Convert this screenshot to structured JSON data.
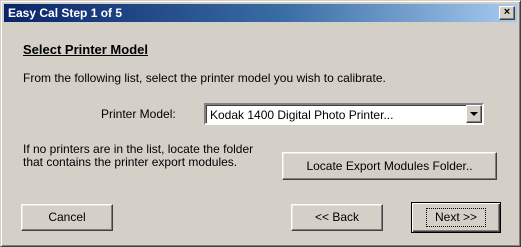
{
  "window": {
    "title": "Easy Cal Step 1 of 5",
    "close_glyph": "×"
  },
  "content": {
    "heading": "Select Printer Model",
    "instruction": "From the following list, select the printer model you wish to calibrate.",
    "model_label": "Printer Model:",
    "model_selected": "Kodak 1400 Digital Photo Printer...",
    "note": "If no printers are in the list, locate the folder that contains the printer export modules."
  },
  "buttons": {
    "locate": "Locate Export Modules Folder..",
    "cancel": "Cancel",
    "back": "<< Back",
    "next": "Next >>"
  },
  "icons": {
    "close": "close-icon",
    "dropdown": "chevron-down-icon"
  },
  "colors": {
    "titlebar_start": "#0a246a",
    "titlebar_end": "#a6caf0",
    "face": "#d4d0c8"
  }
}
